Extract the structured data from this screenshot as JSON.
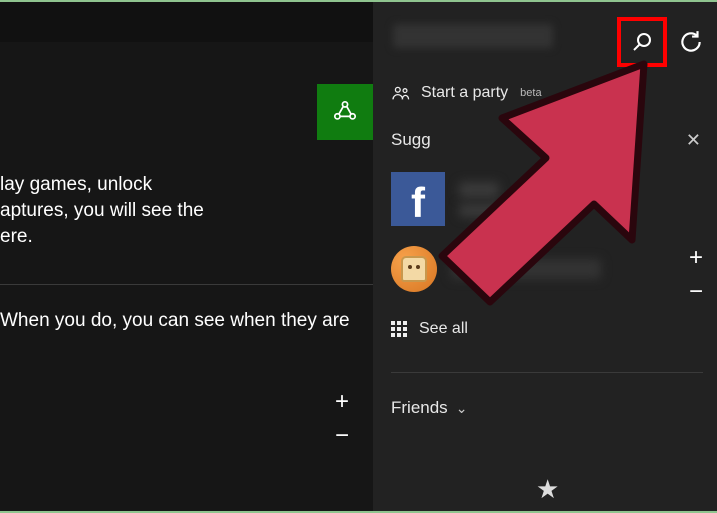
{
  "left": {
    "text1_line1": "lay games, unlock",
    "text1_line2": "aptures, you will see the",
    "text1_line3": "ere.",
    "text2": "When you do, you can see when they are"
  },
  "right": {
    "party_label": "Start a party",
    "party_badge": "beta",
    "suggestions_header": "Sugg",
    "fb_link_account": "ccount",
    "fb_friends_suffix": "ends",
    "see_all_label": "See all",
    "friends_header": "Friends"
  },
  "colors": {
    "accent_green": "#107c10",
    "fb_blue": "#3b5998",
    "highlight_red": "#ff0000",
    "arrow_fill": "#c9324f"
  }
}
